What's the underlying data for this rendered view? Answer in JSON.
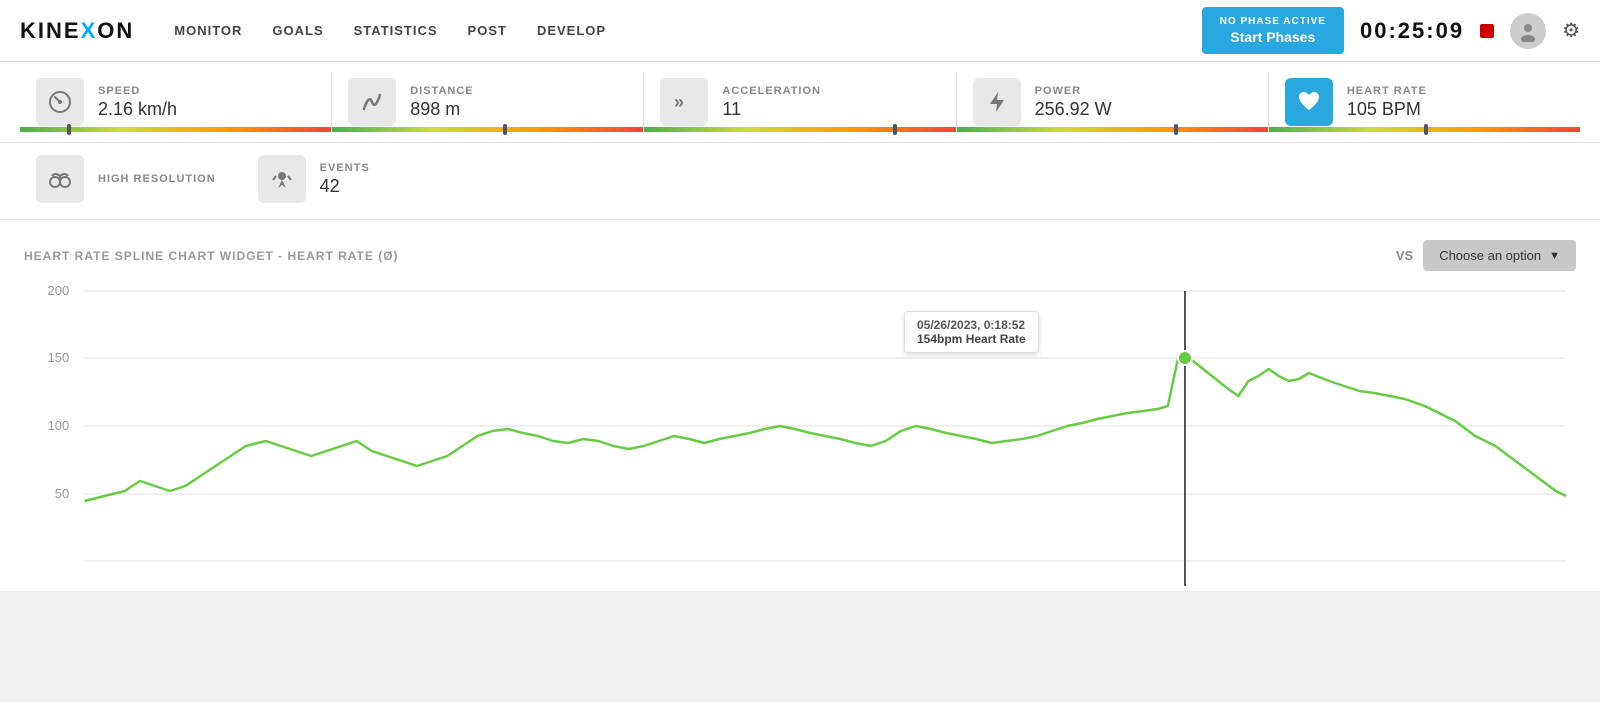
{
  "logo": {
    "text_before": "KINE",
    "x_char": "X",
    "text_after": "ON"
  },
  "nav": {
    "links": [
      "MONITOR",
      "GOALS",
      "STATISTICS",
      "POST",
      "DEVELOP"
    ]
  },
  "header": {
    "phase_label": "NO PHASE ACTIVE",
    "start_label": "Start Phases",
    "timer": "00:25:09"
  },
  "metrics": [
    {
      "icon": "⟳",
      "label": "SPEED",
      "value": "2.16 km/h",
      "bar_pct": 15,
      "indicator_pct": 15
    },
    {
      "icon": "↩",
      "label": "DISTANCE",
      "value": "898 m",
      "bar_pct": 55,
      "indicator_pct": 55
    },
    {
      "icon": "»",
      "label": "ACCELERATION",
      "value": "11",
      "bar_pct": 80,
      "indicator_pct": 80
    },
    {
      "icon": "⚡",
      "label": "POWER",
      "value": "256.92 W",
      "bar_pct": 70,
      "indicator_pct": 70
    },
    {
      "icon": "♥",
      "label": "HEART RATE",
      "value": "105 BPM",
      "active": true,
      "bar_pct": 50,
      "indicator_pct": 50
    }
  ],
  "metrics2": [
    {
      "icon": "🔭",
      "label": "HIGH RESOLUTION",
      "value": ""
    },
    {
      "icon": "🏃",
      "label": "EVENTS",
      "value": "42"
    }
  ],
  "chart": {
    "title": "HEART RATE SPLINE CHART WIDGET - HEART RATE (Ø)",
    "vs_label": "VS",
    "choose_option_label": "Choose an option",
    "y_axis_label": "Heart Rate (Ø)",
    "y_max": 200,
    "y_min": 50,
    "gridlines": [
      200,
      150,
      100,
      50
    ],
    "tooltip": {
      "date": "05/26/2023, 0:18:52",
      "value": "154bpm",
      "metric": "Heart Rate"
    }
  }
}
